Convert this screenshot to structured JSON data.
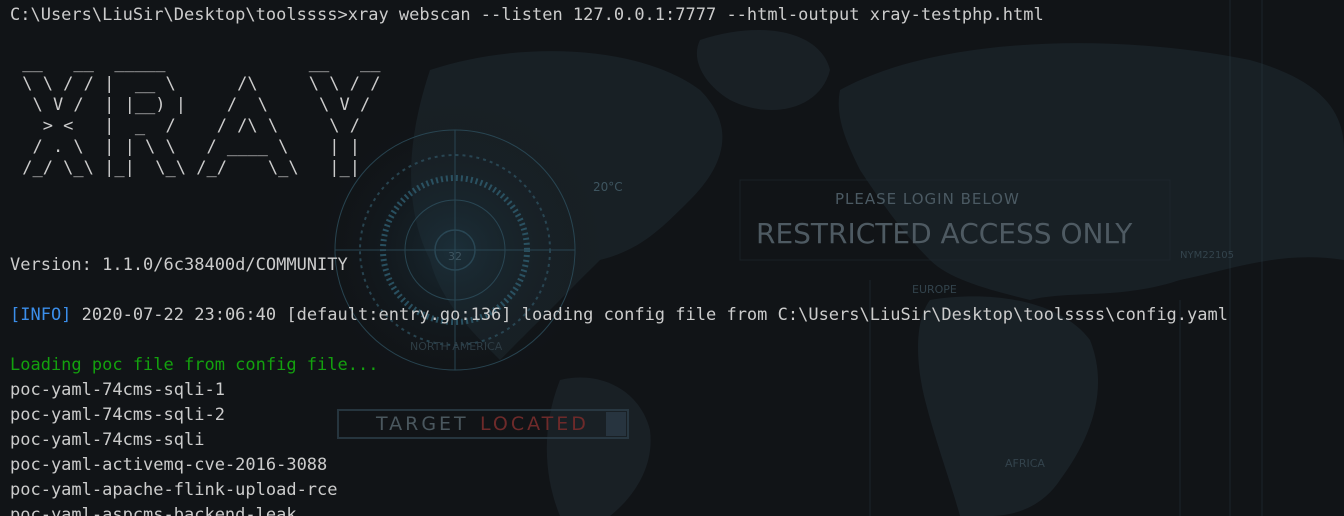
{
  "terminal": {
    "prompt_line": "C:\\Users\\LiuSir\\Desktop\\toolssss>xray webscan --listen 127.0.0.1:7777 --html-output xray-testphp.html",
    "banner": [
      " __   __  _____              __   __",
      " \\ \\ / / |  __ \\      /\\     \\ \\ / /",
      "  \\ V /  | |__) |    /  \\     \\ V / ",
      "   > <   |  _  /    / /\\ \\     \\ /  ",
      "  / . \\  | | \\ \\   / ____ \\    | |  ",
      " /_/ \\_\\ |_|  \\_\\ /_/    \\_\\   |_|  "
    ],
    "version_line": "Version: 1.1.0/6c38400d/COMMUNITY",
    "info_tag": "[INFO]",
    "info_message": " 2020-07-22 23:06:40 [default:entry.go:136] loading config file from C:\\Users\\LiuSir\\Desktop\\toolssss\\config.yaml",
    "loading_line": "Loading poc file from config file...",
    "poc_files": [
      "poc-yaml-74cms-sqli-1",
      "poc-yaml-74cms-sqli-2",
      "poc-yaml-74cms-sqli",
      "poc-yaml-activemq-cve-2016-3088",
      "poc-yaml-apache-flink-upload-rce",
      "poc-yaml-aspcms-backend-leak"
    ]
  },
  "wallpaper": {
    "please_login": "PLEASE LOGIN BELOW",
    "restricted": "RESTRICTED ACCESS ONLY",
    "target": "TARGET",
    "located": "LOCATED",
    "temp": "20°C",
    "dial_number": "32",
    "europe": "EUROPE",
    "africa": "AFRICA",
    "north_america": "NORTH AMERICA",
    "coords": "NYM22105"
  },
  "colors": {
    "info_tag": "#3b8eea",
    "loading_text": "#13a10e",
    "default_text": "#cccccc",
    "located_text": "#7a2a2a"
  }
}
